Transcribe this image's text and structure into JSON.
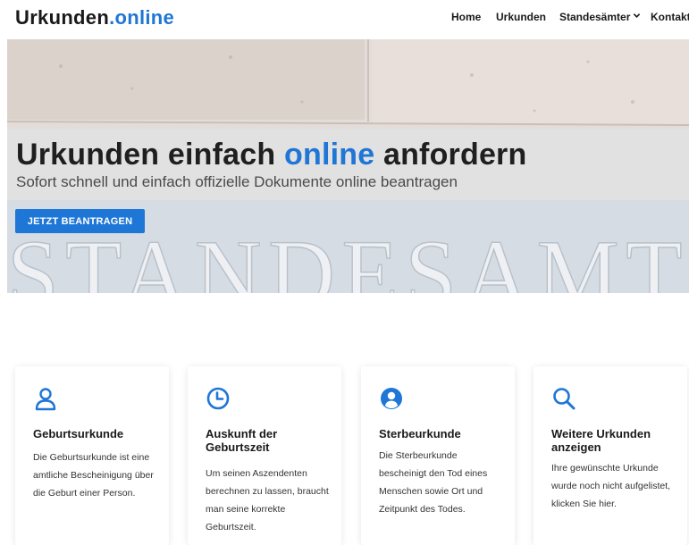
{
  "header": {
    "logo_main": "Urkunden",
    "logo_accent": ".online",
    "nav": {
      "home": "Home",
      "urkunden": "Urkunden",
      "standesaemter": "Standesämter",
      "kontakt": "Kontakt"
    }
  },
  "hero": {
    "title_before": "Urkunden einfach ",
    "title_highlight": "online",
    "title_after": " anfordern",
    "subtitle": "Sofort schnell und einfach offizielle Dokumente online beantragen",
    "button": "JETZT BEANTRAGEN",
    "background_text": "STANDESAMT"
  },
  "cards": [
    {
      "icon": "user-icon",
      "title": "Geburtsurkunde",
      "text": "Die Geburtsurkunde ist eine amtliche Bescheinigung über die Geburt einer Person."
    },
    {
      "icon": "clock-icon",
      "title": "Auskunft der Geburtszeit",
      "text": "Um seinen Aszendenten berechnen zu lassen, braucht man seine korrekte Geburtszeit."
    },
    {
      "icon": "person-circle-icon",
      "title": "Sterbeurkunde",
      "text": "Die Sterbeurkunde bescheinigt den Tod eines Menschen sowie Ort und Zeitpunkt des Todes."
    },
    {
      "icon": "search-icon",
      "title": "Weitere Urkunden anzeigen",
      "text": "Ihre gewünschte Urkunde wurde noch nicht aufgelistet, klicken Sie hier."
    }
  ],
  "colors": {
    "accent": "#1e76d6",
    "text": "#1a1a1a"
  }
}
